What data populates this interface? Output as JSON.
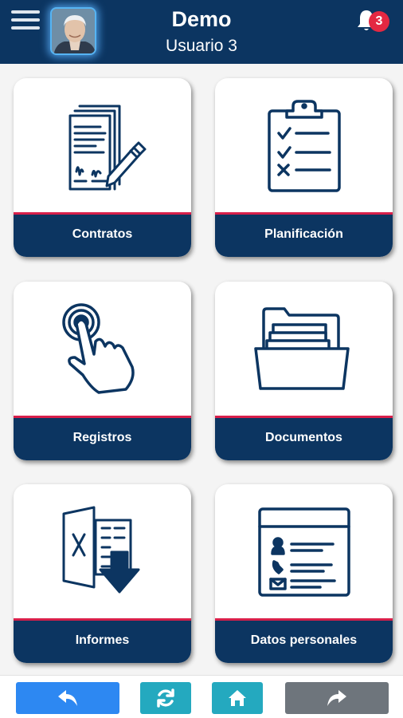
{
  "header": {
    "title": "Demo",
    "subtitle": "Usuario 3",
    "notification_count": "3",
    "menu_icon": "hamburger-menu-icon",
    "notification_icon": "bell-icon"
  },
  "tiles": [
    {
      "label": "Contratos",
      "icon": "contracts-icon"
    },
    {
      "label": "Planificación",
      "icon": "clipboard-checklist-icon"
    },
    {
      "label": "Registros",
      "icon": "hand-tap-icon"
    },
    {
      "label": "Documentos",
      "icon": "open-folder-icon"
    },
    {
      "label": "Informes",
      "icon": "excel-download-icon"
    },
    {
      "label": "Datos personales",
      "icon": "contact-card-icon"
    }
  ],
  "footer": {
    "buttons": [
      {
        "icon": "back-arrow-icon",
        "color": "#2d88f2"
      },
      {
        "icon": "refresh-icon",
        "color": "#24a9bf"
      },
      {
        "icon": "home-icon",
        "color": "#24a9bf"
      },
      {
        "icon": "forward-arrow-icon",
        "color": "#6e757c"
      }
    ]
  },
  "colors": {
    "primary": "#0c3561",
    "accent_stripe": "#d81f4a",
    "badge": "#e32842",
    "background": "#f4f4f4"
  }
}
